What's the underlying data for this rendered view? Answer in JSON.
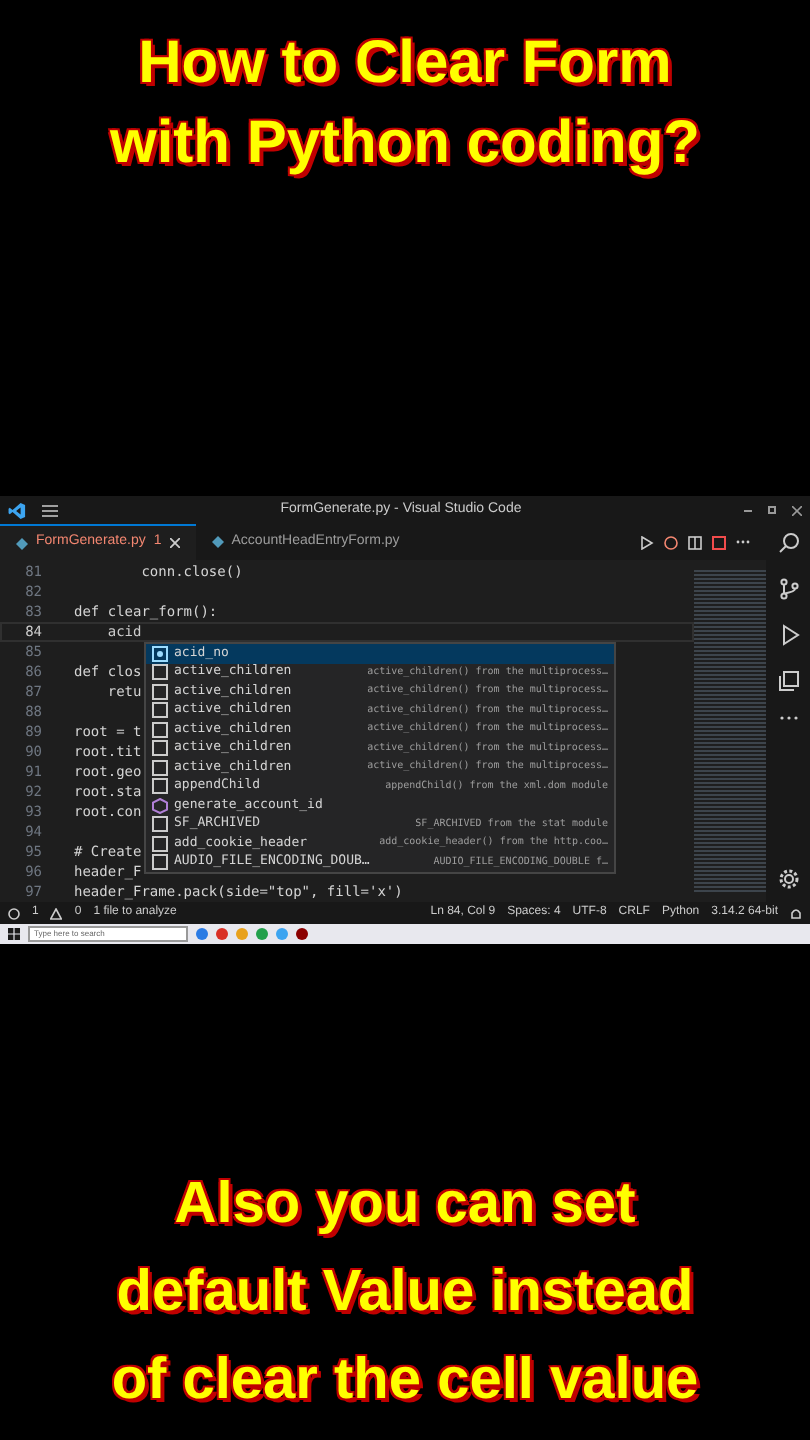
{
  "headline": [
    "How to Clear Form",
    "with Python coding?"
  ],
  "window": {
    "title": "FormGenerate.py - Visual Studio Code"
  },
  "tabs": [
    {
      "label": "FormGenerate.py",
      "badge": "1",
      "selected": true
    },
    {
      "label": "AccountHeadEntryForm.py",
      "selected": false
    }
  ],
  "editor": {
    "lines": [
      {
        "number": "81",
        "code": "        conn.close()",
        "current": false
      },
      {
        "number": "82",
        "current": false
      },
      {
        "number": "83",
        "code": "def clear_form():",
        "current": false
      },
      {
        "number": "84",
        "code": "    acid",
        "current": true
      },
      {
        "number": "85",
        "current": false
      },
      {
        "number": "86",
        "code": "def clos",
        "current": false
      },
      {
        "number": "87",
        "code": "    retu",
        "current": false
      },
      {
        "number": "88",
        "current": false
      },
      {
        "number": "89",
        "code": "root = t",
        "current": false
      },
      {
        "number": "90",
        "code": "root.tit",
        "current": false
      },
      {
        "number": "91",
        "code": "root.geo",
        "current": false
      },
      {
        "number": "92",
        "code": "root.sta",
        "current": false
      },
      {
        "number": "93",
        "code": "root.con",
        "current": false
      },
      {
        "number": "94",
        "current": false
      },
      {
        "number": "95",
        "code": "# Create",
        "current": false
      },
      {
        "number": "96",
        "code": "header_F",
        "current": false
      },
      {
        "number": "97",
        "code": "header_Frame.pack(side=\"top\", fill='x')",
        "current": false
      }
    ],
    "suggestions": [
      {
        "kind": "variable",
        "label": "acid_no",
        "selected": true
      },
      {
        "kind": "text",
        "label": "active_children",
        "detail": "active_children() from the multiprocess…",
        "selected": false
      },
      {
        "kind": "text",
        "label": "active_children",
        "detail": "active_children() from the multiprocess…",
        "selected": false
      },
      {
        "kind": "text",
        "label": "active_children",
        "detail": "active_children() from the multiprocess…",
        "selected": false
      },
      {
        "kind": "text",
        "label": "active_children",
        "detail": "active_children() from the multiprocess…",
        "selected": false
      },
      {
        "kind": "text",
        "label": "active_children",
        "detail": "active_children() from the multiprocess…",
        "selected": false
      },
      {
        "kind": "text",
        "label": "active_children",
        "detail": "active_children() from the multiprocess…",
        "selected": false
      },
      {
        "kind": "text",
        "label": "appendChild",
        "detail": "appendChild() from the xml.dom module",
        "selected": false
      },
      {
        "kind": "function",
        "label": "generate_account_id",
        "selected": false
      },
      {
        "kind": "text",
        "label": "SF_ARCHIVED",
        "detail": "SF_ARCHIVED from the stat module",
        "selected": false
      },
      {
        "kind": "text",
        "label": "add_cookie_header",
        "detail": "add_cookie_header() from the http.coo…",
        "selected": false
      },
      {
        "kind": "text",
        "label": "AUDIO_FILE_ENCODING_DOUB…",
        "detail": "AUDIO_FILE_ENCODING_DOUBLE f…",
        "selected": false
      }
    ]
  },
  "status_bar": {
    "errors": "1",
    "warnings": "0",
    "analysis": "1 file to analyze",
    "position": "Ln 84, Col 9",
    "spaces": "Spaces: 4",
    "encoding": "UTF-8",
    "eol": "CRLF",
    "language": "Python",
    "interpreter": "3.14.2 64-bit"
  },
  "taskbar": {
    "search_placeholder": "Type here to search"
  },
  "caption": [
    "Also you can set",
    "default Value instead",
    "of clear the cell value"
  ]
}
